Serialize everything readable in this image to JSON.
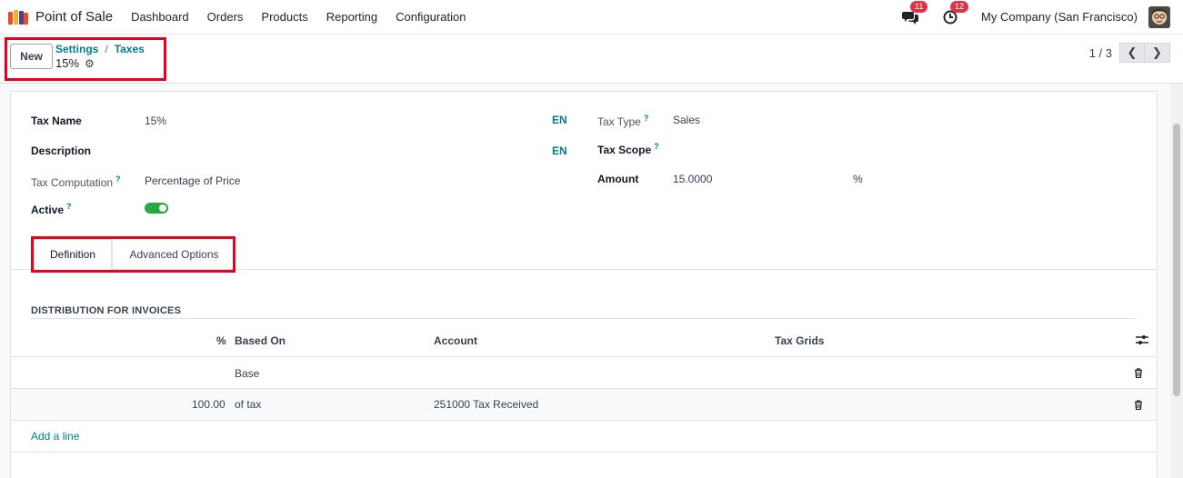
{
  "navbar": {
    "app_name": "Point of Sale",
    "menu": [
      "Dashboard",
      "Orders",
      "Products",
      "Reporting",
      "Configuration"
    ],
    "messages_count": "11",
    "activities_count": "12",
    "company": "My Company (San Francisco)",
    "logo_colors": [
      "#e84f1f",
      "#f0b429",
      "#5b3a8c",
      "#e84f1f"
    ]
  },
  "control_panel": {
    "new_label": "New",
    "breadcrumb": [
      "Settings",
      "Taxes"
    ],
    "record_title": "15%",
    "pager_value": "1 / 3"
  },
  "form": {
    "tax_name_label": "Tax Name",
    "tax_name_value": "15%",
    "description_label": "Description",
    "lang_label": "EN",
    "tax_computation_label": "Tax Computation",
    "tax_computation_value": "Percentage of Price",
    "active_label": "Active",
    "tax_type_label": "Tax Type",
    "tax_type_value": "Sales",
    "tax_scope_label": "Tax Scope",
    "amount_label": "Amount",
    "amount_value": "15.0000",
    "amount_unit": "%",
    "tooltip_marker": "?"
  },
  "tabs": [
    "Definition",
    "Advanced Options"
  ],
  "distribution": {
    "title": "DISTRIBUTION FOR INVOICES",
    "columns": [
      "%",
      "Based On",
      "Account",
      "Tax Grids"
    ],
    "rows": [
      {
        "percent": "",
        "based_on": "Base",
        "account": "",
        "tax_grids": ""
      },
      {
        "percent": "100.00",
        "based_on": "of tax",
        "account": "251000 Tax Received",
        "tax_grids": ""
      }
    ],
    "add_line": "Add a line"
  },
  "colors": {
    "accent": "#017e84",
    "highlight": "#e8001c",
    "toggle_on": "#28a745",
    "badge": "#dc3545"
  }
}
